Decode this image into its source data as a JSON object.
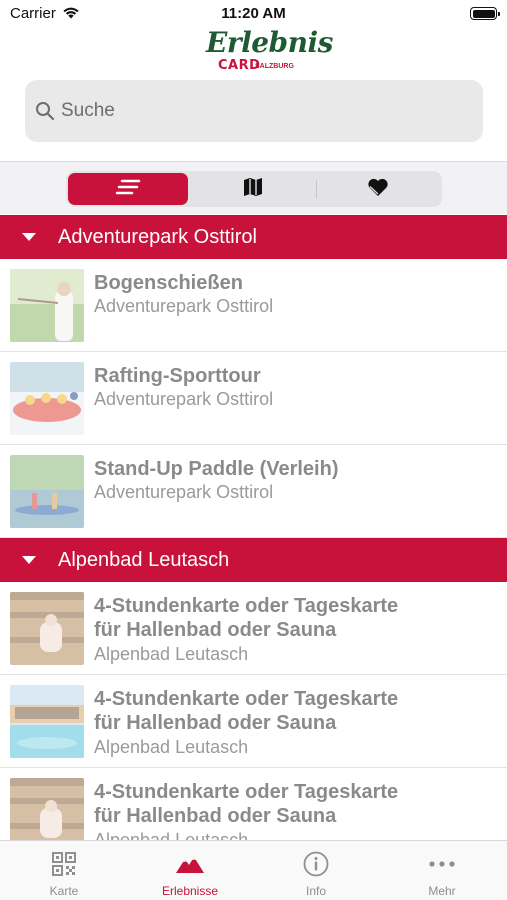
{
  "status_bar": {
    "carrier": "Carrier",
    "time": "11:20 AM"
  },
  "logo": {
    "script_text": "Erlebnis",
    "card_text": "CARD",
    "sub_text": "SALZBURG"
  },
  "search": {
    "placeholder": "Suche",
    "value": ""
  },
  "view_switcher": {
    "options": [
      "list-icon",
      "map-icon",
      "favorites-heart-icon"
    ],
    "selected_index": 0
  },
  "colors": {
    "brand": "#c8123c",
    "logo_green": "#1e5b34"
  },
  "sections": [
    {
      "title": "Adventurepark Osttirol",
      "items": [
        {
          "title": "Bogenschießen",
          "subtitle": "Adventurepark Osttirol"
        },
        {
          "title": "Rafting-Sporttour",
          "subtitle": "Adventurepark Osttirol"
        },
        {
          "title": "Stand-Up Paddle (Verleih)",
          "subtitle": "Adventurepark Osttirol"
        }
      ]
    },
    {
      "title": "Alpenbad Leutasch",
      "items": [
        {
          "title_line1": "4-Stundenkarte oder Tageskarte",
          "title_line2": "für Hallenbad oder Sauna",
          "subtitle": "Alpenbad Leutasch"
        },
        {
          "title_line1": "4-Stundenkarte oder Tageskarte",
          "title_line2": "für Hallenbad oder Sauna",
          "subtitle": "Alpenbad Leutasch"
        },
        {
          "title_line1": "4-Stundenkarte oder Tageskarte",
          "title_line2": "für Hallenbad oder Sauna",
          "subtitle": "Alpenbad Leutasch"
        }
      ]
    }
  ],
  "tab_bar": {
    "tabs": [
      {
        "label": "Karte",
        "icon": "qr-code-icon"
      },
      {
        "label": "Erlebnisse",
        "icon": "mountain-icon"
      },
      {
        "label": "Info",
        "icon": "info-icon"
      },
      {
        "label": "Mehr",
        "icon": "more-dots-icon"
      }
    ],
    "selected_index": 1
  }
}
